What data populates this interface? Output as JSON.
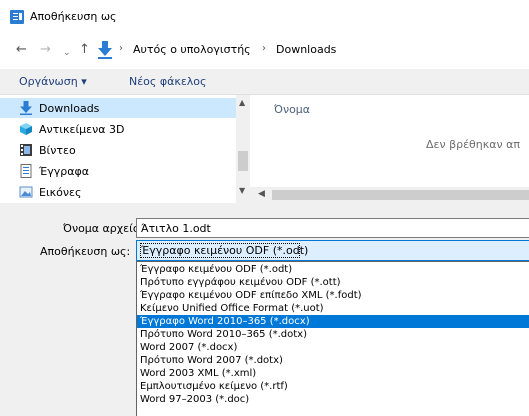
{
  "window": {
    "title": "Αποθήκευση ως"
  },
  "address": {
    "back": "←",
    "forward": "→",
    "recent": "⌄",
    "up": "↑",
    "separator": "›",
    "crumbs": [
      "Αυτός ο υπολογιστής",
      "Downloads"
    ]
  },
  "toolbar": {
    "organize_label": "Οργάνωση ▾",
    "new_folder_label": "Νέος φάκελος"
  },
  "nav": {
    "items": [
      {
        "label": "Downloads",
        "icon": "download-icon"
      },
      {
        "label": "Αντικείμενα 3D",
        "icon": "3d-objects-icon"
      },
      {
        "label": "Βίντεο",
        "icon": "video-icon"
      },
      {
        "label": "Έγγραφα",
        "icon": "documents-icon"
      },
      {
        "label": "Εικόνες",
        "icon": "pictures-icon"
      }
    ],
    "selected": 0
  },
  "content": {
    "column_name": "Όνομα",
    "empty_message": "Δεν βρέθηκαν απ"
  },
  "form": {
    "filename_label": "Όνομα αρχείου:",
    "filename_value": "Άτιτλο 1.odt",
    "savetype_label": "Αποθήκευση ως:",
    "savetype_value": "Έγγραφο κειμένου ODF (*.odt)"
  },
  "filetypes": {
    "options": [
      "Έγγραφο κειμένου ODF (*.odt)",
      "Πρότυπο εγγράφου κειμένου ODF (*.ott)",
      "Έγγραφο κειμένου ODF επίπεδο XML (*.fodt)",
      "Κείμενο Unified Office Format (*.uot)",
      "Έγγραφο Word 2010–365 (*.docx)",
      "Πρότυπο Word 2010–365 (*.dotx)",
      "Word 2007 (*.docx)",
      "Πρότυπο Word 2007 (*.dotx)",
      "Word 2003 XML (*.xml)",
      "Εμπλουτισμένο κείμενο (*.rtf)",
      "Word 97–2003 (*.doc)"
    ],
    "highlighted": 4
  },
  "colors": {
    "accent": "#0078d7",
    "selection_light": "#cce8ff",
    "folder_yellow": "#e8b64a",
    "download_blue": "#2b7cd3"
  }
}
